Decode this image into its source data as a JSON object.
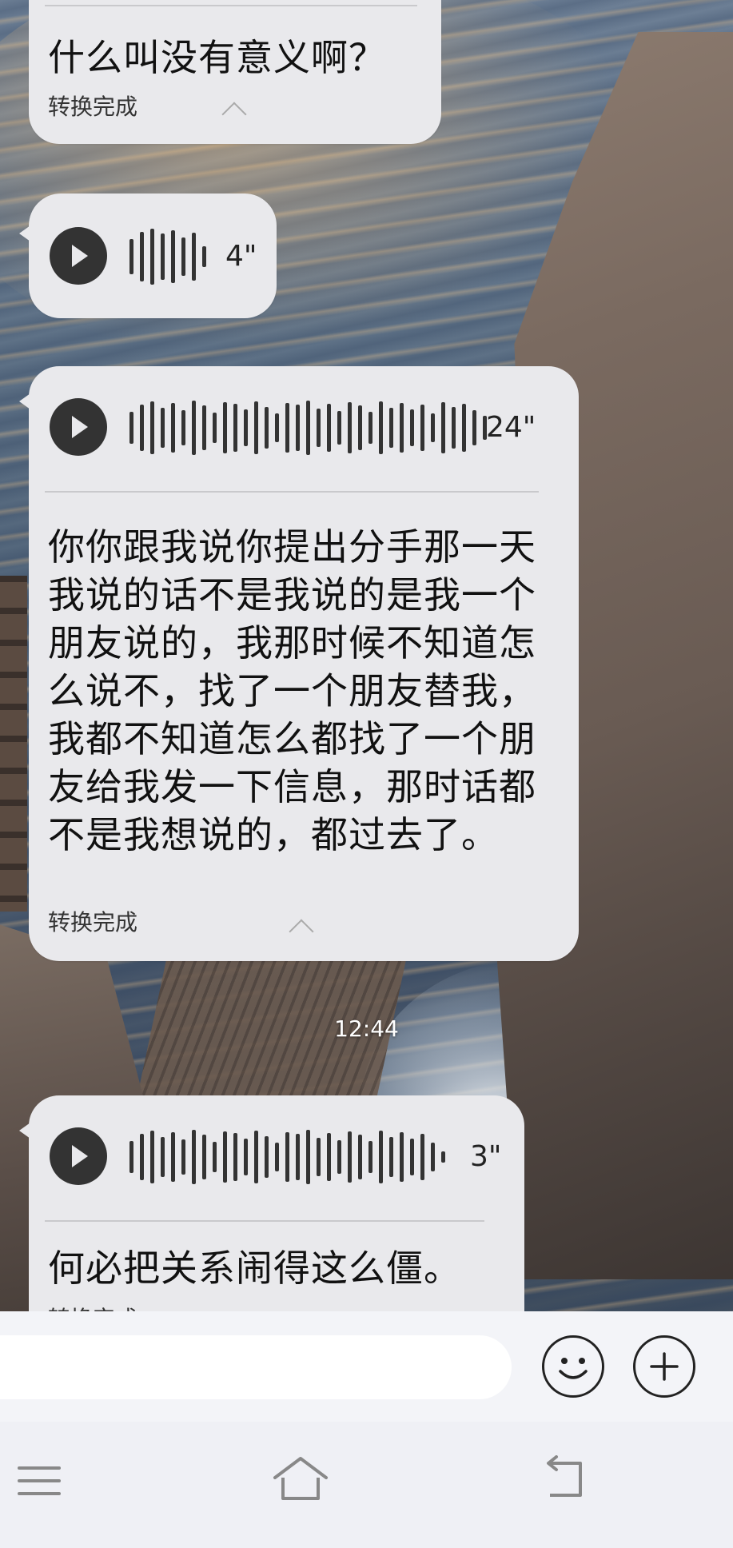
{
  "messages": [
    {
      "transcription": "什么叫没有意义啊？",
      "status": "转换完成"
    },
    {
      "duration": "4\""
    },
    {
      "duration": "24\"",
      "transcription": "你你跟我说你提出分手那一天我说的话不是我说的是我一个朋友说的，我那时候不知道怎么说不，找了一个朋友替我，我都不知道怎么都找了一个朋友给我发一下信息，那时话都不是我想说的，都过去了。",
      "status": "转换完成"
    },
    {
      "duration": "3\"",
      "transcription": "何必把关系闹得这么僵。",
      "status": "转换完成"
    }
  ],
  "timestamp": "12:44",
  "input": {
    "value": "",
    "placeholder": ""
  },
  "icons": {
    "play": "play-icon",
    "collapse": "chevron-up-icon",
    "emoji": "smiley-icon",
    "more": "plus-icon",
    "menu": "hamburger-icon",
    "home": "home-icon",
    "back": "back-icon"
  },
  "colors": {
    "bubble": "#e9e9ec",
    "input_bar": "#f3f4f8",
    "nav_bar": "#eff0f5",
    "text": "#111111"
  }
}
